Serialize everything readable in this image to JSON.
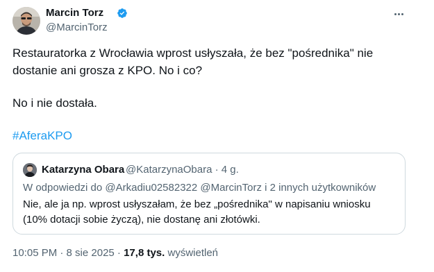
{
  "author": {
    "name": "Marcin Torz",
    "handle": "@MarcinTorz"
  },
  "tweet": {
    "line1": "Restauratorka z Wrocławia wprost usłyszała, że bez \"pośrednika\" nie",
    "line2": "dostanie ani grosza z KPO. No i co?",
    "line3": "No i nie dostała.",
    "hashtag": "#AferaKPO"
  },
  "quote": {
    "name": "Katarzyna Obara",
    "handle_time": "@KatarzynaObara · 4 g.",
    "reply_to": "W odpowiedzi do @Arkadiu02582322 @MarcinTorz  i 2 innych użytkowników",
    "text_line1": "Nie, ale ja np. wprost usłyszałam, że bez „pośrednika\" w napisaniu wniosku",
    "text_line2": "(10% dotacji sobie życzą), nie dostanę ani złotówki."
  },
  "meta": {
    "timestamp": "10:05 PM · 8 sie 2025 · ",
    "views_count": "17,8 tys.",
    "views_label": " wyświetleń"
  },
  "colors": {
    "accent": "#1d9bf0",
    "secondary_text": "#536471",
    "primary_text": "#0f1419",
    "border": "#cfd9de"
  },
  "icons": {
    "verified": "verified-badge-icon",
    "more": "more-options-icon"
  }
}
